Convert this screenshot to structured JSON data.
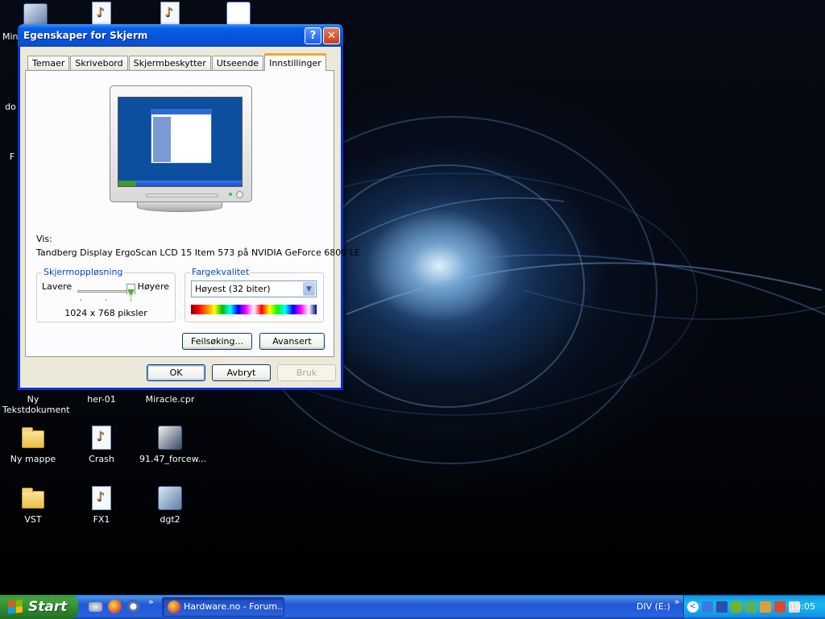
{
  "desktop": {
    "icons": [
      {
        "label": "Min",
        "icon": "computer-icon"
      },
      {
        "label": "do",
        "icon": "document-icon"
      },
      {
        "label": "F",
        "icon": "document-icon"
      },
      {
        "label": "Ny Tekstdokument",
        "icon": "text-document-icon"
      },
      {
        "label": "her-01",
        "icon": "audio-file-icon"
      },
      {
        "label": "Miracle.cpr",
        "icon": "audio-file-icon"
      },
      {
        "label": "Ny mappe",
        "icon": "folder-icon"
      },
      {
        "label": "Crash",
        "icon": "audio-file-icon"
      },
      {
        "label": "91.47_forcew...",
        "icon": "installer-icon"
      },
      {
        "label": "VST",
        "icon": "folder-icon"
      },
      {
        "label": "FX1",
        "icon": "audio-file-icon"
      },
      {
        "label": "dgt2",
        "icon": "application-icon"
      }
    ]
  },
  "dialog": {
    "title": "Egenskaper for Skjerm",
    "help_glyph": "?",
    "close_glyph": "✕",
    "tabs": [
      {
        "label": "Temaer",
        "active": false
      },
      {
        "label": "Skrivebord",
        "active": false
      },
      {
        "label": "Skjermbeskytter",
        "active": false
      },
      {
        "label": "Utseende",
        "active": false
      },
      {
        "label": "Innstillinger",
        "active": true
      }
    ],
    "display": {
      "label": "Vis:",
      "value": "Tandberg Display ErgoScan LCD 15 Item 573 på NVIDIA GeForce 6800 LE"
    },
    "resolution": {
      "group_label": "Skjermoppløsning",
      "low_label": "Lavere",
      "high_label": "Høyere",
      "value": "1024 x 768 piksler",
      "slider_position_fraction": 1.0
    },
    "color_quality": {
      "group_label": "Fargekvalitet",
      "selected": "Høyest (32 biter)",
      "dropdown_glyph": "▼"
    },
    "buttons": {
      "troubleshoot": "Feilsøking...",
      "advanced": "Avansert",
      "ok": "OK",
      "cancel": "Avbryt",
      "apply": "Bruk"
    }
  },
  "taskbar": {
    "start_label": "Start",
    "quick_launch_chevron": "»",
    "task_button": "Hardware.no - Forum...",
    "drive_label": "DIV (E:)",
    "tray_chevron": "»",
    "clock": "19:05"
  }
}
